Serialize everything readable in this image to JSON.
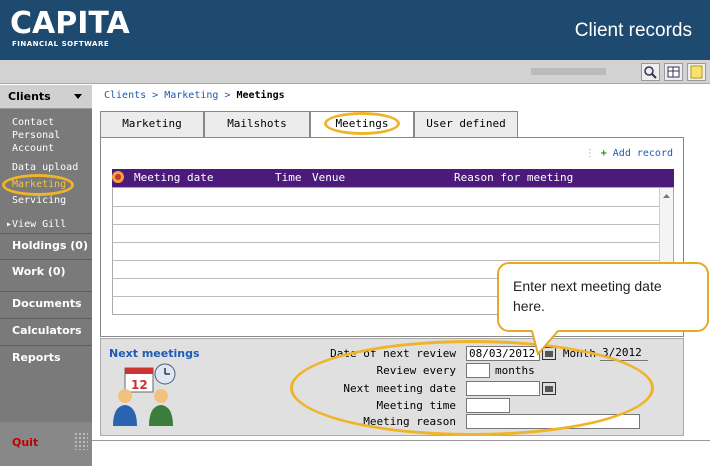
{
  "header": {
    "logo": "CAPITA",
    "logo_sub": "FINANCIAL SOFTWARE",
    "title": "Client records"
  },
  "sidebar": {
    "dropdown": "Clients",
    "links": [
      "Contact",
      "Personal",
      "Account",
      "Data upload",
      "Marketing",
      "Servicing"
    ],
    "view_link": "View Gill",
    "sections": [
      "Holdings (0)",
      "Work (0)",
      "Documents",
      "Calculators",
      "Reports"
    ],
    "quit": "Quit"
  },
  "breadcrumb": {
    "part1": "Clients",
    "sep": " > ",
    "part2": "Marketing",
    "current": "Meetings"
  },
  "tabs": [
    "Marketing",
    "Mailshots",
    "Meetings",
    "User defined"
  ],
  "add_record": "Add record",
  "grid": {
    "columns": [
      "Meeting date",
      "Time",
      "Venue",
      "Reason for meeting"
    ]
  },
  "next_meetings": {
    "title": "Next meetings",
    "date_of_next_review_label": "Date of next review",
    "date_of_next_review_value": "08/03/2012",
    "month_label": "Month",
    "month_value": "3/2012",
    "review_every_label": "Review every",
    "review_every_value": "",
    "months_label": "months",
    "next_meeting_date_label": "Next meeting date",
    "next_meeting_date_value": "",
    "meeting_time_label": "Meeting time",
    "meeting_time_value": "",
    "meeting_reason_label": "Meeting reason",
    "meeting_reason_value": ""
  },
  "callout": {
    "text": "Enter next meeting date here."
  },
  "colors": {
    "header_bg": "#1e4a70",
    "grid_header": "#4b1a7a",
    "highlight": "#f0b42a",
    "link": "#1d5bb5",
    "quit": "#c00000"
  }
}
